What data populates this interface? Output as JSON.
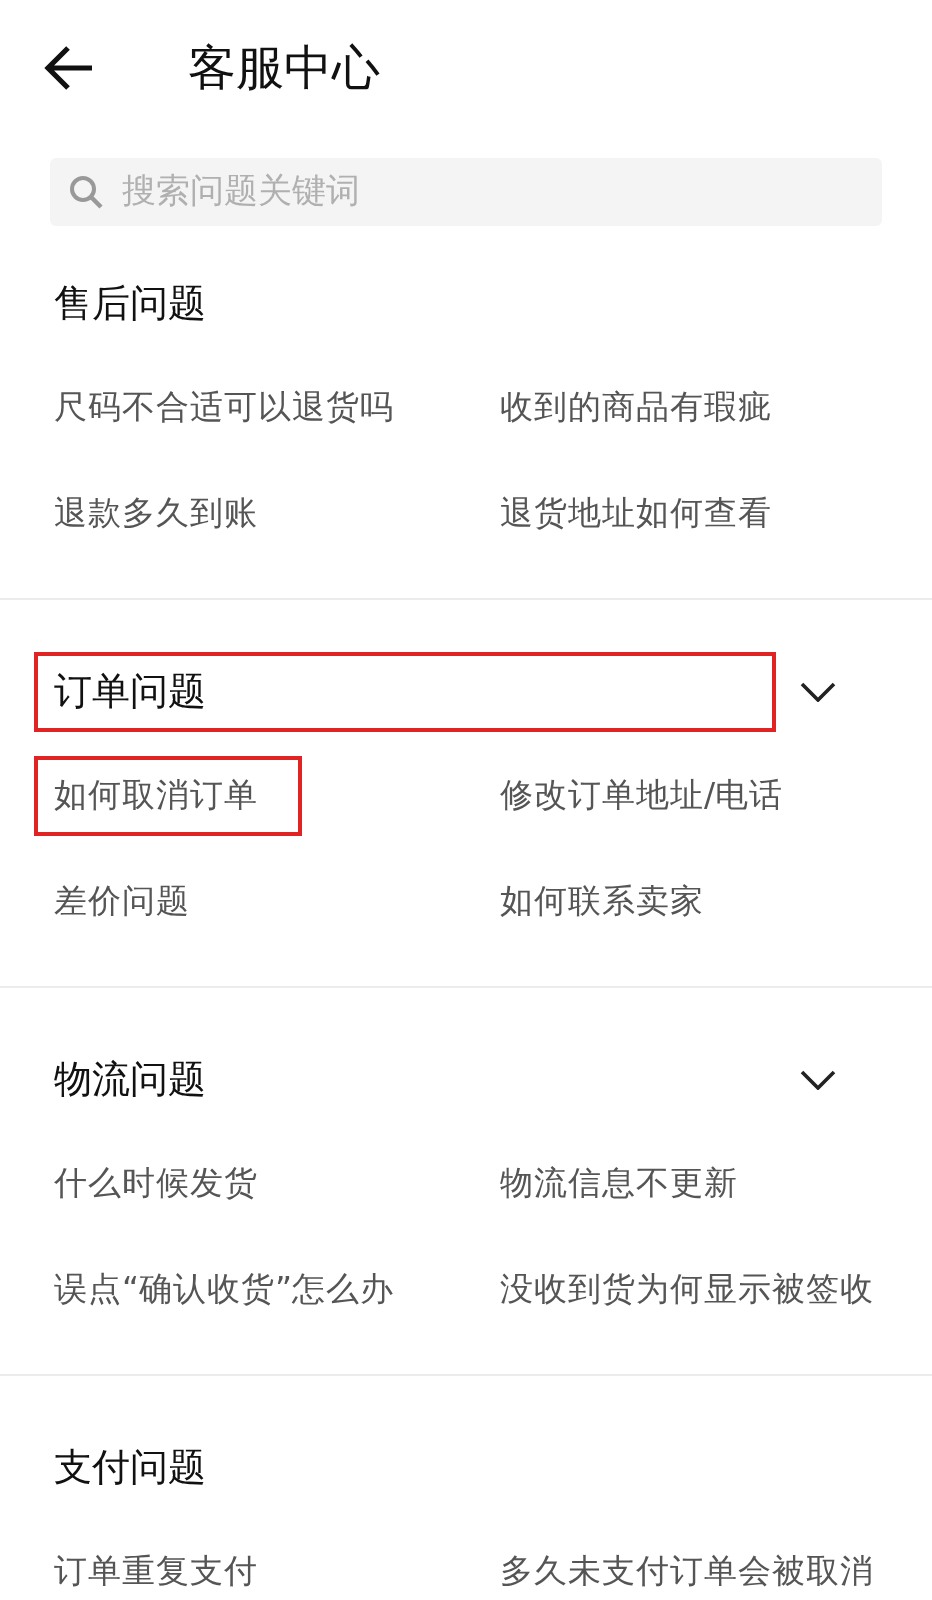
{
  "header": {
    "title": "客服中心"
  },
  "search": {
    "placeholder": "搜索问题关键词"
  },
  "sections": [
    {
      "title": "售后问题",
      "has_toggle": false,
      "highlighted": false,
      "items": [
        {
          "label": "尺码不合适可以退货吗",
          "highlighted": false
        },
        {
          "label": "收到的商品有瑕疵",
          "highlighted": false
        },
        {
          "label": "退款多久到账",
          "highlighted": false
        },
        {
          "label": "退货地址如何查看",
          "highlighted": false
        }
      ]
    },
    {
      "title": "订单问题",
      "has_toggle": true,
      "highlighted": true,
      "items": [
        {
          "label": "如何取消订单",
          "highlighted": true
        },
        {
          "label": "修改订单地址/电话",
          "highlighted": false
        },
        {
          "label": "差价问题",
          "highlighted": false
        },
        {
          "label": "如何联系卖家",
          "highlighted": false
        }
      ]
    },
    {
      "title": "物流问题",
      "has_toggle": true,
      "highlighted": false,
      "items": [
        {
          "label": "什么时候发货",
          "highlighted": false
        },
        {
          "label": "物流信息不更新",
          "highlighted": false
        },
        {
          "label": "误点“确认收货”怎么办",
          "highlighted": false
        },
        {
          "label": "没收到货为何显示被签收",
          "highlighted": false
        }
      ]
    },
    {
      "title": "支付问题",
      "has_toggle": false,
      "highlighted": false,
      "items": [
        {
          "label": "订单重复支付",
          "highlighted": false
        },
        {
          "label": "多久未支付订单会被取消",
          "highlighted": false
        }
      ]
    }
  ]
}
